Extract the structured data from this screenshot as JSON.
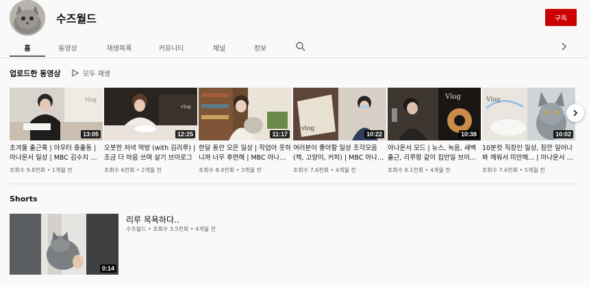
{
  "channel": {
    "name": "수즈월드",
    "subscribe_label": "구독"
  },
  "tabs": [
    {
      "label": "홈",
      "active": true
    },
    {
      "label": "동영상",
      "active": false
    },
    {
      "label": "재생목록",
      "active": false
    },
    {
      "label": "커뮤니티",
      "active": false
    },
    {
      "label": "채널",
      "active": false
    },
    {
      "label": "정보",
      "active": false
    }
  ],
  "icons": {
    "search": "search-icon",
    "tabs_next": "chevron-right-icon",
    "play": "play-icon",
    "carousel_next": "chevron-right-icon"
  },
  "uploads": {
    "title": "업로드한 동영상",
    "play_all_label": "모두 재생",
    "videos": [
      {
        "title": "초겨울 출근룩 | 아우터 충출동 | 아나운서 일상 | MBC 김수지 브이로그",
        "meta": "조회수 9.8천회 • 1개월 전",
        "duration": "13:05"
      },
      {
        "title": "오붓한 저녁 먹방 (with 김리루) | 조금 더 마음 쓰며 살기 브이로그",
        "meta": "조회수 6천회 • 2개월 전",
        "duration": "12:25"
      },
      {
        "title": "한달 동안 모은 일상 | 작업아 웃하니까 너무 후련해 | MBC 아나운서 브이로그",
        "meta": "조회수 8.4천회 • 3개월 전",
        "duration": "11:17"
      },
      {
        "title": "여러분이 좋아할 일상 조각모음 (책, 고양이, 커피) | MBC 아나운서",
        "meta": "조회수 7.6천회 • 4개월 전",
        "duration": "10:22"
      },
      {
        "title": "아나운서 모드 | 뉴스, 녹음, 새벽 출근, 리루랑 같이 집안일 브이로그",
        "meta": "조회수 8.1천회 • 4개월 전",
        "duration": "10:38"
      },
      {
        "title": "10분컷 직장인 일상, 잠깐 일어나 봐 깨워서 미안해... | 아나운서 브이로그",
        "meta": "조회수 7.6천회 • 5개월 전",
        "duration": "10:02"
      }
    ]
  },
  "shorts": {
    "title": "Shorts",
    "item": {
      "title": "리루 목욕하다..",
      "meta": "수즈월드 • 조회수 3.5천회 • 4개월 전",
      "duration": "0:14"
    }
  },
  "colors": {
    "subscribe": "#cc0000",
    "background": "#f9f9f9",
    "text_secondary": "#606060"
  }
}
